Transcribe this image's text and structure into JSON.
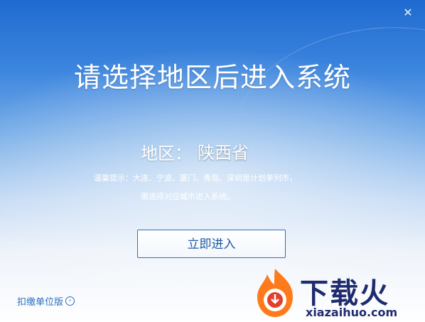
{
  "window": {
    "close_glyph": "✕"
  },
  "title": "请选择地区后进入系统",
  "region": {
    "label": "地区：",
    "value": "陕西省"
  },
  "tip": {
    "line1": "温馨提示：大连、宁波、厦门、青岛、深圳是计划单列市，",
    "line2": "需选择对应城市进入系统。"
  },
  "enter_button": "立即进入",
  "bottom_link": {
    "label": "扣缴单位版",
    "arrow_glyph": "›"
  },
  "watermark": {
    "brand": "下载火",
    "site": "xiazaihuo.com",
    "logo_colors": [
      "#ff7a1a",
      "#e0412a"
    ]
  }
}
